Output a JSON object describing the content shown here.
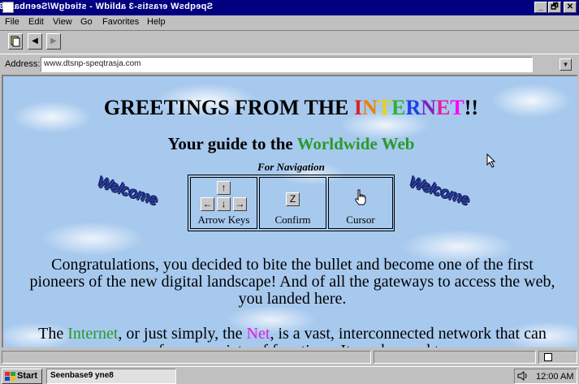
{
  "window": {
    "title": "SpeqbsW erastis-3 ablidW - stiedgW/Seenbase9",
    "controls": {
      "minimize": "_",
      "maximize": "🗗",
      "close": "✕"
    }
  },
  "menu": [
    "File",
    "Edit",
    "View",
    "Go",
    "Favorites",
    "Help"
  ],
  "toolbar": {
    "back": "◀",
    "forward": "▶"
  },
  "address": {
    "label": "Address:",
    "value": "www.dtsnp-speqtrasja.com"
  },
  "page": {
    "heading_prefix": "GREETINGS FROM THE ",
    "heading_rainbow": [
      "I",
      "N",
      "T",
      "E",
      "R",
      "N",
      "E",
      "T"
    ],
    "heading_suffix": "!!",
    "rainbow_colors": [
      "#e02020",
      "#f08000",
      "#f0d000",
      "#30b030",
      "#2040e0",
      "#8020c0",
      "#e020a0",
      "#ff00ff"
    ],
    "subheading_prefix": "Your guide to the ",
    "subheading_highlight": "Worldwide Web",
    "nav_caption": "For Navigation",
    "nav": {
      "arrow_keys_label": "Arrow Keys",
      "confirm_label": "Confirm",
      "confirm_key": "Z",
      "cursor_label": "Cursor",
      "arrow_up": "↑",
      "arrow_left": "←",
      "arrow_down": "↓",
      "arrow_right": "→"
    },
    "welcome_left": "Welcome",
    "welcome_right": "Welcome",
    "paragraph1": "Congratulations, you decided to bite the bullet and become one of the first pioneers of the new digital landscape! And of all the gateways to access the web, you landed here.",
    "paragraph2_a": "The ",
    "paragraph2_internet": "Internet",
    "paragraph2_b": ", or just simply, the ",
    "paragraph2_net": "Net",
    "paragraph2_c": ", is a vast, interconnected network that can perform a variety of functions. It can be used to"
  },
  "taskbar": {
    "start_label": "Start",
    "task_label": "Seenbase9 yne8",
    "clock": "12:00 AM"
  },
  "colors": {
    "green": "#2a9a2a",
    "magenta": "#e020e0",
    "title_bar": "#000080"
  }
}
